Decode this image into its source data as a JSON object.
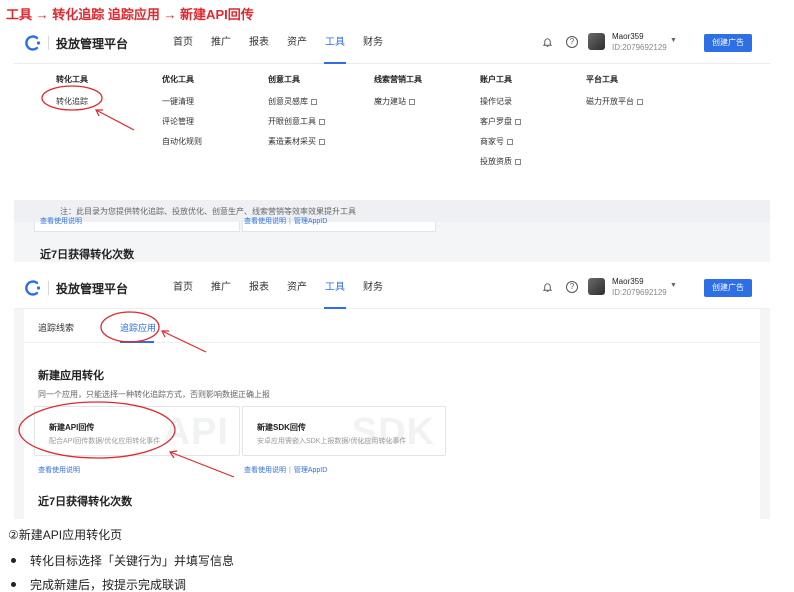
{
  "heading": "工具 → 转化追踪 追踪应用 → 新建API回传",
  "app": {
    "title": "投放管理平台",
    "nav": [
      "首页",
      "推广",
      "报表",
      "资产",
      "工具",
      "财务"
    ],
    "active_nav": "工具",
    "user_name": "Maor359",
    "user_id": "ID:2079692129",
    "create_button": "创建广告"
  },
  "dropdown": {
    "columns": [
      {
        "title": "转化工具",
        "items": [
          "转化追踪"
        ]
      },
      {
        "title": "优化工具",
        "items": [
          "一键清理",
          "评论管理",
          "自动化规则"
        ]
      },
      {
        "title": "创意工具",
        "items": [
          "创意灵感库",
          "开眼创意工具",
          "素造素材采买"
        ]
      },
      {
        "title": "线索营销工具",
        "items": [
          "魔力建站"
        ]
      },
      {
        "title": "账户工具",
        "items": [
          "操作记录",
          "客户罗盘",
          "商家号",
          "投放资质"
        ]
      },
      {
        "title": "平台工具",
        "items": [
          "磁力开放平台"
        ]
      }
    ],
    "note": "注：此目录为您提供转化追踪、投放优化、创意生产、线索营销等效率效果提升工具"
  },
  "screen1": {
    "help_left": "查看使用说明",
    "help_right": "查看使用说明",
    "help_right_link2": "管理AppID",
    "section_title": "近7日获得转化次数"
  },
  "screen2": {
    "tabs": [
      "追踪线索",
      "追踪应用"
    ],
    "sub_title": "新建应用转化",
    "sub_desc": "同一个应用，只能选择一种转化追踪方式，否则影响数据正确上报",
    "cards": [
      {
        "title": "新建API回传",
        "desc": "配合API回传数据/优化应用转化事件",
        "watermark": "API"
      },
      {
        "title": "新建SDK回传",
        "desc": "安卓应用需嵌入SDK上报数据/优化应用转化事件",
        "watermark": "SDK"
      }
    ],
    "help_left": "查看使用说明",
    "help_right": "查看使用说明",
    "help_right_link2": "管理AppID",
    "section_title": "近7日获得转化次数"
  },
  "caption": "②新建API应用转化页",
  "bullets": [
    "转化目标选择「关键行为」并填写信息",
    "完成新建后，按提示完成联调"
  ],
  "colors": {
    "accent": "#2f6fe6",
    "annotation": "#e0282e"
  }
}
